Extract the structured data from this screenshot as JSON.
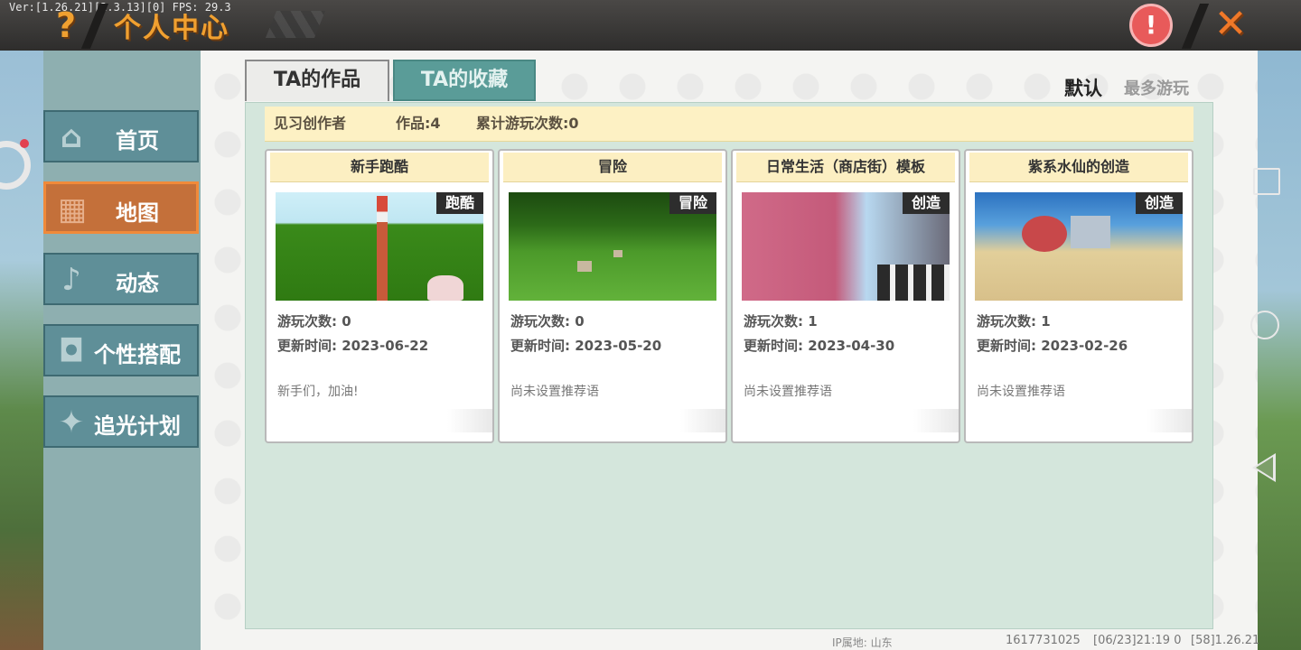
{
  "header": {
    "version": "Ver:[1.26.21][2.3.13][0] FPS: 29.3",
    "help_icon": "?",
    "title": "个人中心",
    "warning_icon": "!",
    "close_icon": "✕"
  },
  "sidebar": {
    "items": [
      {
        "label": "首页",
        "icon": "home-icon",
        "glyph": "⌂",
        "active": false
      },
      {
        "label": "地图",
        "icon": "map-icon",
        "glyph": "▦",
        "active": true
      },
      {
        "label": "动态",
        "icon": "bell-icon",
        "glyph": "♪",
        "active": false
      },
      {
        "label": "个性搭配",
        "icon": "outfit-icon",
        "glyph": "◘",
        "active": false
      },
      {
        "label": "追光计划",
        "icon": "plan-icon",
        "glyph": "✦",
        "active": false
      }
    ]
  },
  "tabs": {
    "works": "TA的作品",
    "favorites": "TA的收藏"
  },
  "sort": {
    "default": "默认",
    "most_played": "最多游玩"
  },
  "info": {
    "level": "见习创作者",
    "works": "作品:4",
    "plays": "累计游玩次数:0"
  },
  "cards": [
    {
      "title": "新手跑酷",
      "tag": "跑酷",
      "plays": "游玩次数: 0",
      "updated": "更新时间: 2023-06-22",
      "desc": "新手们，加油!"
    },
    {
      "title": "冒险",
      "tag": "冒险",
      "plays": "游玩次数: 0",
      "updated": "更新时间: 2023-05-20",
      "desc": "尚未设置推荐语"
    },
    {
      "title": "日常生活（商店街）模板",
      "tag": "创造",
      "plays": "游玩次数: 1",
      "updated": "更新时间: 2023-04-30",
      "desc": "尚未设置推荐语"
    },
    {
      "title": "紫系水仙的创造",
      "tag": "创造",
      "plays": "游玩次数: 1",
      "updated": "更新时间: 2023-02-26",
      "desc": "尚未设置推荐语"
    }
  ],
  "footer": {
    "ip": "IP属地: 山东",
    "user_id": "1617731025",
    "time": "[06/23]21:19 0",
    "build": "[58]1.26.21"
  },
  "colors": {
    "accent": "#f0a030",
    "tab_active": "#5a9c98",
    "nav_active": "#c4703a"
  }
}
